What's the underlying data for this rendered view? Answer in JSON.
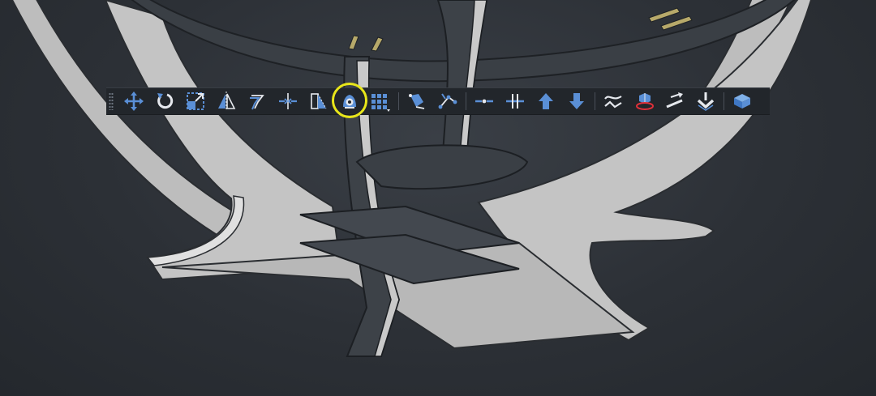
{
  "viewport": {
    "description_label": ""
  },
  "colors": {
    "toolbar_bg": "#22262b",
    "icon_blue": "#5a8fd6",
    "icon_white": "#e6e9ee",
    "highlight": "#e8e61a",
    "model_light": "#c8c8c8",
    "model_dark": "#3d4248"
  },
  "toolbar": {
    "groups": [
      [
        "move-icon",
        "rotate-icon",
        "scale-icon",
        "mirror-icon",
        "offset-icon",
        "stretch-icon",
        "align-icon",
        "clone-icon",
        "array-icon"
      ],
      [
        "lofts-icon",
        "sweep-icon"
      ],
      [
        "join-icon",
        "split-icon",
        "upgrade-icon",
        "downgrade-icon"
      ],
      [
        "wire-to-bspline-icon",
        "shape-2d-view-icon",
        "draft-to-sketch-icon",
        "array-path-icon"
      ],
      [
        "working-plane-icon"
      ]
    ],
    "highlighted_tool": "clone-icon"
  }
}
